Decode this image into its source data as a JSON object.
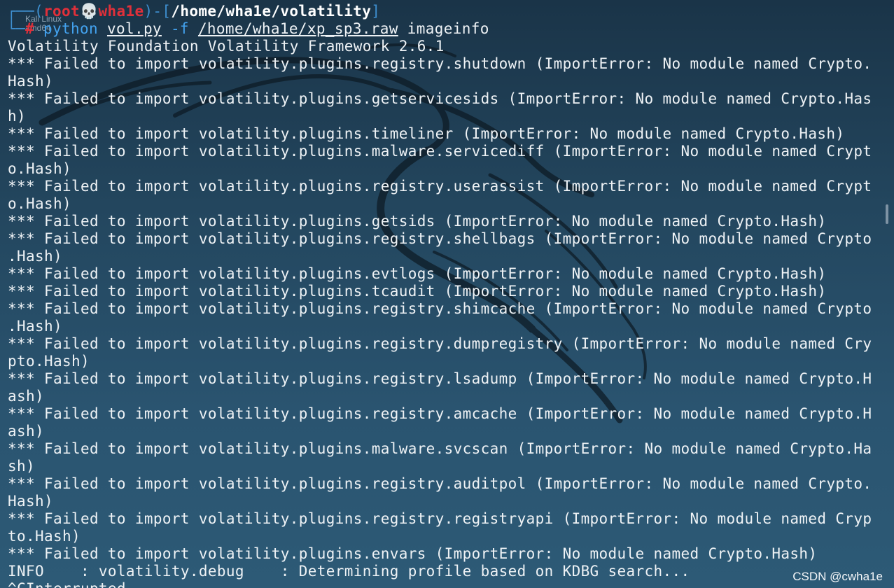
{
  "desktop": {
    "icon_label_line1": "Kali Linux",
    "icon_label_line2": "amd64"
  },
  "prompt": {
    "box_open": "┌──(",
    "user": "root",
    "skull": "💀",
    "host": "wha1e",
    "mid": ")-[",
    "path": "/home/wha1e/volatility",
    "close": "]",
    "box_bottom": "└─",
    "hash": "# ",
    "command_program": "python",
    "command_script": "vol.py",
    "command_flag": "-f",
    "command_file": "/home/wha1e/xp_sp3.raw",
    "command_plugin": "imageinfo"
  },
  "output_lines": [
    "Volatility Foundation Volatility Framework 2.6.1",
    "*** Failed to import volatility.plugins.registry.shutdown (ImportError: No module named Crypto.",
    "Hash)",
    "*** Failed to import volatility.plugins.getservicesids (ImportError: No module named Crypto.Has",
    "h)",
    "*** Failed to import volatility.plugins.timeliner (ImportError: No module named Crypto.Hash)",
    "*** Failed to import volatility.plugins.malware.servicediff (ImportError: No module named Crypt",
    "o.Hash)",
    "*** Failed to import volatility.plugins.registry.userassist (ImportError: No module named Crypt",
    "o.Hash)",
    "*** Failed to import volatility.plugins.getsids (ImportError: No module named Crypto.Hash)",
    "*** Failed to import volatility.plugins.registry.shellbags (ImportError: No module named Crypto",
    ".Hash)",
    "*** Failed to import volatility.plugins.evtlogs (ImportError: No module named Crypto.Hash)",
    "*** Failed to import volatility.plugins.tcaudit (ImportError: No module named Crypto.Hash)",
    "*** Failed to import volatility.plugins.registry.shimcache (ImportError: No module named Crypto",
    ".Hash)",
    "*** Failed to import volatility.plugins.registry.dumpregistry (ImportError: No module named Cry",
    "pto.Hash)",
    "*** Failed to import volatility.plugins.registry.lsadump (ImportError: No module named Crypto.H",
    "ash)",
    "*** Failed to import volatility.plugins.registry.amcache (ImportError: No module named Crypto.H",
    "ash)",
    "*** Failed to import volatility.plugins.malware.svcscan (ImportError: No module named Crypto.Ha",
    "sh)",
    "*** Failed to import volatility.plugins.registry.auditpol (ImportError: No module named Crypto.",
    "Hash)",
    "*** Failed to import volatility.plugins.registry.registryapi (ImportError: No module named Cryp",
    "to.Hash)",
    "*** Failed to import volatility.plugins.envars (ImportError: No module named Crypto.Hash)",
    "INFO    : volatility.debug    : Determining profile based on KDBG search...",
    "^CInterrupted"
  ],
  "watermark": "CSDN @cwha1e",
  "colors": {
    "background_top": "#1a3448",
    "background_bottom": "#2d5a76",
    "prompt_user": "#e0303a",
    "prompt_box": "#3e8fd0",
    "command": "#43a2ee",
    "text": "#eef2f5"
  }
}
